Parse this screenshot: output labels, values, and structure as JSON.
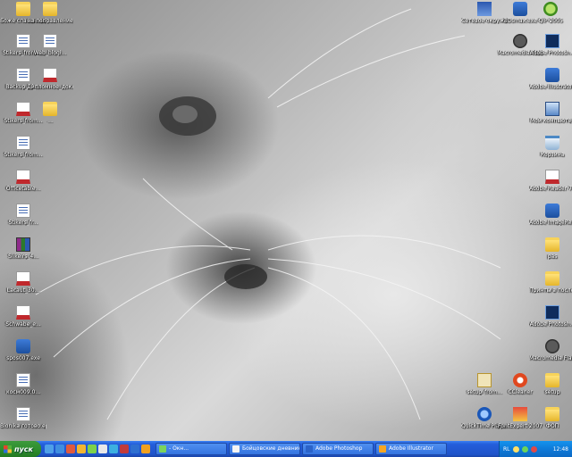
{
  "desktop": {
    "icons_left": [
      {
        "label": "Боже спасенный",
        "glyph": "folder"
      },
      {
        "label": "на поправление",
        "glyph": "folder"
      },
      {
        "label": "Stikers_from_...",
        "glyph": "doc"
      },
      {
        "label": "Web_blogi...",
        "glyph": "doc"
      },
      {
        "label": "Backup_of_...",
        "glyph": "doc"
      },
      {
        "label": "Дипломное_доклад",
        "glyph": "pdf"
      },
      {
        "label": "Stikers_from...",
        "glyph": "pdf"
      },
      {
        "label": "...",
        "glyph": "folder"
      },
      {
        "label": "Stikers_from...",
        "glyph": "doc"
      },
      {
        "label": "Officetable...",
        "glyph": "pdf"
      },
      {
        "label": "Stikers_fr...",
        "glyph": "doc"
      },
      {
        "label": "Slikeirs_4...",
        "glyph": "rar"
      },
      {
        "label": "Lacaut_30...",
        "glyph": "pdf"
      },
      {
        "label": "Schwabe_e...",
        "glyph": "pdf"
      },
      {
        "label": "spos007.exe",
        "glyph": "app"
      },
      {
        "label": "косм009.0...",
        "glyph": "doc"
      },
      {
        "label": "Bionika готово.eps",
        "glyph": "doc"
      }
    ],
    "icons_right": [
      {
        "label": "QIP 2005",
        "glyph": "qip"
      },
      {
        "label": "Сетевое окружение",
        "glyph": "net"
      },
      {
        "label": "3Dsmax.exe",
        "glyph": "app"
      },
      {
        "label": "Macromedia Flash Pla...",
        "glyph": "flash"
      },
      {
        "label": "Adobe Photosh...",
        "glyph": "ps"
      },
      {
        "label": "Adobe Illustrator CS2",
        "glyph": "app"
      },
      {
        "label": "Мой компьютер",
        "glyph": "pc"
      },
      {
        "label": "Корзина",
        "glyph": "recycle"
      },
      {
        "label": "Adobe Reader 7.0",
        "glyph": "pdf"
      },
      {
        "label": "Adobe ImageReady",
        "glyph": "app"
      },
      {
        "label": "pas",
        "glyph": "folder"
      },
      {
        "label": "Принты в последн...",
        "glyph": "folder"
      },
      {
        "label": "Adobe Photosh...",
        "glyph": "ps"
      },
      {
        "label": "Macromedia Flash Pla...",
        "glyph": "flash"
      },
      {
        "label": "setup_from...",
        "glyph": "setup"
      },
      {
        "label": "CCleaner",
        "glyph": "ccl"
      },
      {
        "label": "setup",
        "glyph": "folder"
      },
      {
        "label": "QuickTime Player",
        "glyph": "qt"
      },
      {
        "label": "FontExpert 2007",
        "glyph": "fe"
      },
      {
        "label": "ФОП",
        "glyph": "folder"
      }
    ]
  },
  "taskbar": {
    "start_label": "пуск",
    "tasks": [
      {
        "label": "- Окн...",
        "color": "#7bd35c"
      },
      {
        "label": "Бойцовские дневник...",
        "color": "#f4f4f4"
      },
      {
        "label": "Adobe Photoshop",
        "color": "#2b63c9"
      },
      {
        "label": "Adobe Illustrator",
        "color": "#f6a623"
      }
    ],
    "lang": "RL",
    "clock": "12:48"
  }
}
